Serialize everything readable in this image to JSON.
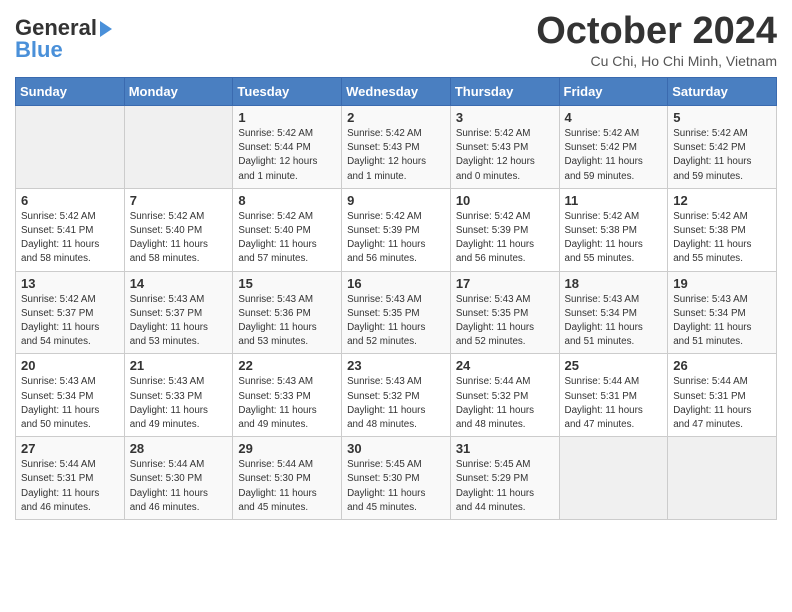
{
  "logo": {
    "line1": "General",
    "line2": "Blue",
    "arrow": "►"
  },
  "title": "October 2024",
  "location": "Cu Chi, Ho Chi Minh, Vietnam",
  "weekdays": [
    "Sunday",
    "Monday",
    "Tuesday",
    "Wednesday",
    "Thursday",
    "Friday",
    "Saturday"
  ],
  "weeks": [
    [
      {
        "day": "",
        "info": ""
      },
      {
        "day": "",
        "info": ""
      },
      {
        "day": "1",
        "info": "Sunrise: 5:42 AM\nSunset: 5:44 PM\nDaylight: 12 hours\nand 1 minute."
      },
      {
        "day": "2",
        "info": "Sunrise: 5:42 AM\nSunset: 5:43 PM\nDaylight: 12 hours\nand 1 minute."
      },
      {
        "day": "3",
        "info": "Sunrise: 5:42 AM\nSunset: 5:43 PM\nDaylight: 12 hours\nand 0 minutes."
      },
      {
        "day": "4",
        "info": "Sunrise: 5:42 AM\nSunset: 5:42 PM\nDaylight: 11 hours\nand 59 minutes."
      },
      {
        "day": "5",
        "info": "Sunrise: 5:42 AM\nSunset: 5:42 PM\nDaylight: 11 hours\nand 59 minutes."
      }
    ],
    [
      {
        "day": "6",
        "info": "Sunrise: 5:42 AM\nSunset: 5:41 PM\nDaylight: 11 hours\nand 58 minutes."
      },
      {
        "day": "7",
        "info": "Sunrise: 5:42 AM\nSunset: 5:40 PM\nDaylight: 11 hours\nand 58 minutes."
      },
      {
        "day": "8",
        "info": "Sunrise: 5:42 AM\nSunset: 5:40 PM\nDaylight: 11 hours\nand 57 minutes."
      },
      {
        "day": "9",
        "info": "Sunrise: 5:42 AM\nSunset: 5:39 PM\nDaylight: 11 hours\nand 56 minutes."
      },
      {
        "day": "10",
        "info": "Sunrise: 5:42 AM\nSunset: 5:39 PM\nDaylight: 11 hours\nand 56 minutes."
      },
      {
        "day": "11",
        "info": "Sunrise: 5:42 AM\nSunset: 5:38 PM\nDaylight: 11 hours\nand 55 minutes."
      },
      {
        "day": "12",
        "info": "Sunrise: 5:42 AM\nSunset: 5:38 PM\nDaylight: 11 hours\nand 55 minutes."
      }
    ],
    [
      {
        "day": "13",
        "info": "Sunrise: 5:42 AM\nSunset: 5:37 PM\nDaylight: 11 hours\nand 54 minutes."
      },
      {
        "day": "14",
        "info": "Sunrise: 5:43 AM\nSunset: 5:37 PM\nDaylight: 11 hours\nand 53 minutes."
      },
      {
        "day": "15",
        "info": "Sunrise: 5:43 AM\nSunset: 5:36 PM\nDaylight: 11 hours\nand 53 minutes."
      },
      {
        "day": "16",
        "info": "Sunrise: 5:43 AM\nSunset: 5:35 PM\nDaylight: 11 hours\nand 52 minutes."
      },
      {
        "day": "17",
        "info": "Sunrise: 5:43 AM\nSunset: 5:35 PM\nDaylight: 11 hours\nand 52 minutes."
      },
      {
        "day": "18",
        "info": "Sunrise: 5:43 AM\nSunset: 5:34 PM\nDaylight: 11 hours\nand 51 minutes."
      },
      {
        "day": "19",
        "info": "Sunrise: 5:43 AM\nSunset: 5:34 PM\nDaylight: 11 hours\nand 51 minutes."
      }
    ],
    [
      {
        "day": "20",
        "info": "Sunrise: 5:43 AM\nSunset: 5:34 PM\nDaylight: 11 hours\nand 50 minutes."
      },
      {
        "day": "21",
        "info": "Sunrise: 5:43 AM\nSunset: 5:33 PM\nDaylight: 11 hours\nand 49 minutes."
      },
      {
        "day": "22",
        "info": "Sunrise: 5:43 AM\nSunset: 5:33 PM\nDaylight: 11 hours\nand 49 minutes."
      },
      {
        "day": "23",
        "info": "Sunrise: 5:43 AM\nSunset: 5:32 PM\nDaylight: 11 hours\nand 48 minutes."
      },
      {
        "day": "24",
        "info": "Sunrise: 5:44 AM\nSunset: 5:32 PM\nDaylight: 11 hours\nand 48 minutes."
      },
      {
        "day": "25",
        "info": "Sunrise: 5:44 AM\nSunset: 5:31 PM\nDaylight: 11 hours\nand 47 minutes."
      },
      {
        "day": "26",
        "info": "Sunrise: 5:44 AM\nSunset: 5:31 PM\nDaylight: 11 hours\nand 47 minutes."
      }
    ],
    [
      {
        "day": "27",
        "info": "Sunrise: 5:44 AM\nSunset: 5:31 PM\nDaylight: 11 hours\nand 46 minutes."
      },
      {
        "day": "28",
        "info": "Sunrise: 5:44 AM\nSunset: 5:30 PM\nDaylight: 11 hours\nand 46 minutes."
      },
      {
        "day": "29",
        "info": "Sunrise: 5:44 AM\nSunset: 5:30 PM\nDaylight: 11 hours\nand 45 minutes."
      },
      {
        "day": "30",
        "info": "Sunrise: 5:45 AM\nSunset: 5:30 PM\nDaylight: 11 hours\nand 45 minutes."
      },
      {
        "day": "31",
        "info": "Sunrise: 5:45 AM\nSunset: 5:29 PM\nDaylight: 11 hours\nand 44 minutes."
      },
      {
        "day": "",
        "info": ""
      },
      {
        "day": "",
        "info": ""
      }
    ]
  ]
}
